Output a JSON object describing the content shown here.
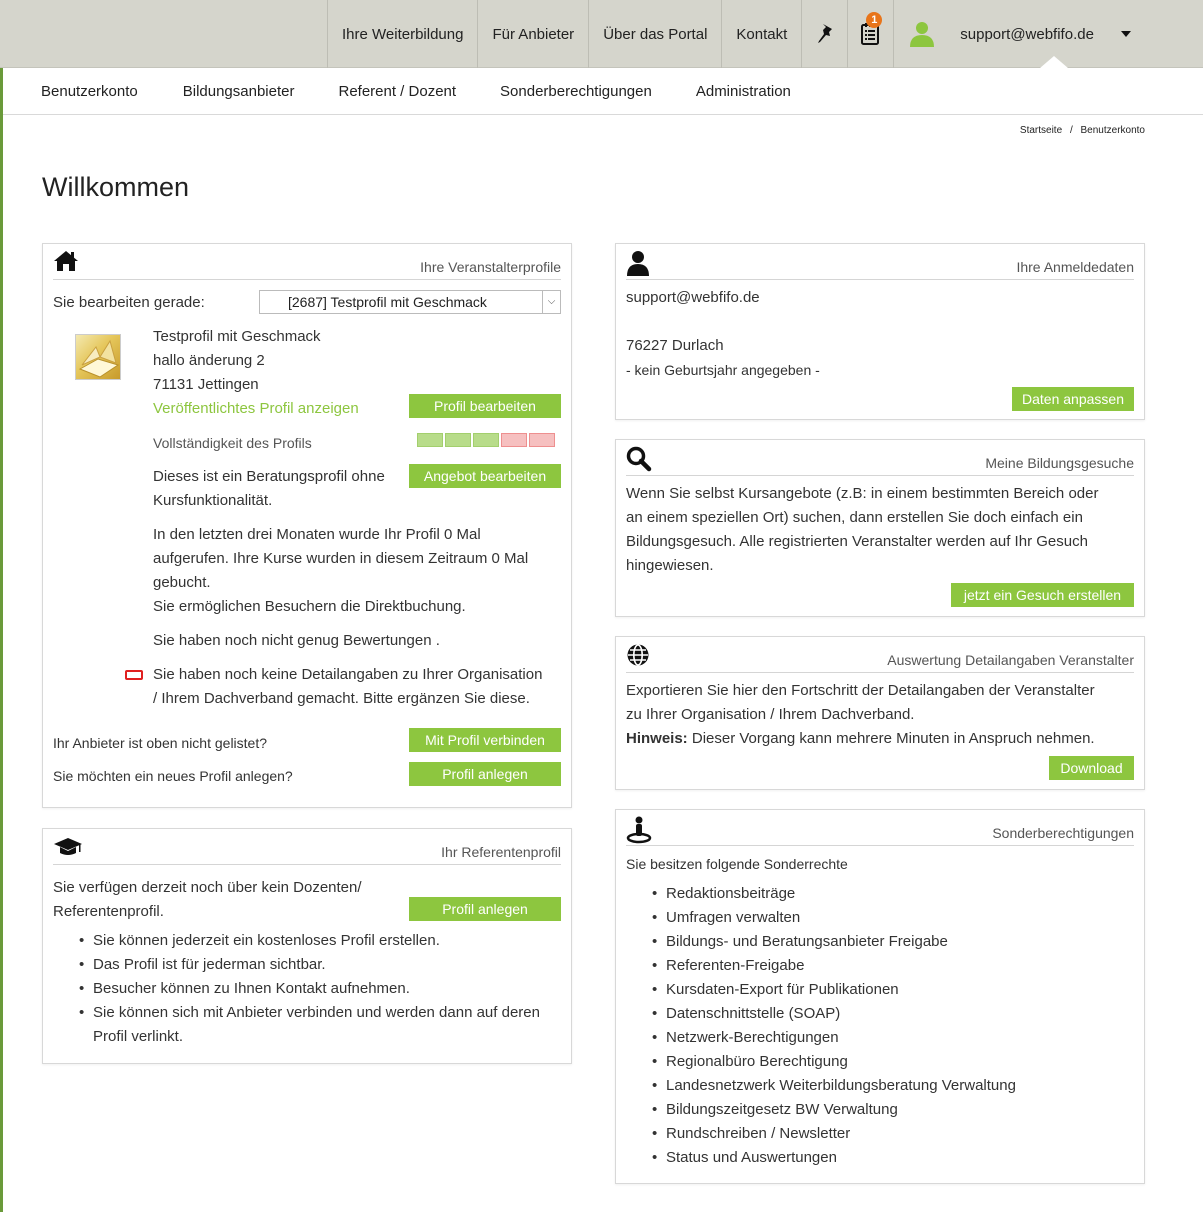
{
  "topnav": {
    "items": [
      "Ihre Weiterbildung",
      "Für Anbieter",
      "Über das Portal",
      "Kontakt"
    ],
    "badge_count": "1",
    "user_email": "support@webfifo.de"
  },
  "subnav": [
    "Benutzerkonto",
    "Bildungsanbieter",
    "Referent / Dozent",
    "Sonderberechtigungen",
    "Administration"
  ],
  "breadcrumb": {
    "home": "Startseite",
    "sep": "/",
    "current": "Benutzerkonto"
  },
  "page_title": "Willkommen",
  "veranstalter": {
    "title": "Ihre Veranstalterprofile",
    "editing_label": "Sie bearbeiten gerade:",
    "select_value": "[2687] Testprofil mit Geschmack",
    "profile_name": "Testprofil mit Geschmack",
    "profile_line2": "hallo änderung 2",
    "profile_line3": "71131 Jettingen",
    "public_link": "Veröffentlichtes Profil anzeigen",
    "edit_profile_btn": "Profil bearbeiten",
    "completeness_label": "Vollständigkeit des Profils",
    "completeness": {
      "filled": 3,
      "total": 5
    },
    "beratung_line1": "Dieses ist ein Beratungsprofil ohne",
    "beratung_line2": "Kursfunktionalität.",
    "edit_offer_btn": "Angebot bearbeiten",
    "stats_line1": "In den letzten drei Monaten wurde Ihr Profil 0 Mal",
    "stats_line2": "aufgerufen. Ihre Kurse wurden in diesem Zeitraum 0 Mal",
    "stats_line3": "gebucht.",
    "stats_line4": "Sie ermöglichen Besuchern die Direktbuchung.",
    "ratings": "Sie haben noch nicht genug Bewertungen .",
    "detail_line1": "Sie haben noch keine Detailangaben zu Ihrer Organisation",
    "detail_line2": "/ Ihrem Dachverband gemacht. Bitte ergänzen Sie diese.",
    "not_listed_label": "Ihr Anbieter ist oben nicht gelistet?",
    "connect_btn": "Mit Profil verbinden",
    "new_profile_label": "Sie möchten ein neues Profil anlegen?",
    "create_btn": "Profil anlegen"
  },
  "referent": {
    "title": "Ihr Referentenprofil",
    "line1": "Sie verfügen derzeit noch über kein Dozenten/",
    "line2": "Referentenprofil.",
    "create_btn": "Profil anlegen",
    "bullets": [
      "Sie können jederzeit ein kostenloses Profil erstellen.",
      "Das Profil ist für jederman sichtbar.",
      "Besucher können zu Ihnen Kontakt aufnehmen.",
      "Sie können sich mit Anbieter verbinden und werden dann auf deren"
    ],
    "bullet_tail": "Profil verlinkt."
  },
  "anmeldedaten": {
    "title": "Ihre Anmeldedaten",
    "email": "support@webfifo.de",
    "city": "76227 Durlach",
    "birthyear": "- kein Geburtsjahr angegeben -",
    "btn": "Daten anpassen"
  },
  "gesuche": {
    "title": "Meine Bildungsgesuche",
    "line1": "Wenn Sie selbst Kursangebote (z.B: in einem bestimmten Bereich oder",
    "line2": "an einem speziellen Ort) suchen, dann erstellen Sie doch einfach ein",
    "line3": "Bildungsgesuch. Alle registrierten Veranstalter werden auf Ihr Gesuch",
    "line4": "hingewiesen.",
    "btn": "jetzt ein Gesuch erstellen"
  },
  "auswertung": {
    "title": "Auswertung Detailangaben Veranstalter",
    "line1": "Exportieren Sie hier den Fortschritt der Detailangaben der Veranstalter",
    "line2": "zu Ihrer Organisation / Ihrem Dachverband.",
    "hint_label": "Hinweis:",
    "hint_text": " Dieser Vorgang kann mehrere Minuten in Anspruch nehmen.",
    "btn": "Download"
  },
  "sonder": {
    "title": "Sonderberechtigungen",
    "intro": "Sie besitzen folgende Sonderrechte",
    "items": [
      "Redaktionsbeiträge",
      "Umfragen verwalten",
      "Bildungs- und Beratungsanbieter Freigabe",
      "Referenten-Freigabe",
      "Kursdaten-Export für Publikationen",
      "Datenschnittstelle (SOAP)",
      "Netzwerk-Berechtigungen",
      "Regionalbüro Berechtigung",
      "Landesnetzwerk Weiterbildungsberatung Verwaltung",
      "Bildungszeitgesetz BW Verwaltung",
      "Rundschreiben / Newsletter",
      "Status und Auswertungen"
    ]
  },
  "colors": {
    "accent_green": "#8dc63f",
    "topbar": "#d5d5cc",
    "frame": "#6a9a3a",
    "badge": "#e8751a",
    "warning_red": "#e02020"
  },
  "icons": [
    "pin-icon",
    "notepad-icon",
    "user-icon",
    "caret-down-icon",
    "home-icon",
    "graduation-cap-icon",
    "person-icon",
    "search-icon",
    "globe-icon",
    "special-rights-icon",
    "select-arrow-icon",
    "warning-box-icon"
  ]
}
